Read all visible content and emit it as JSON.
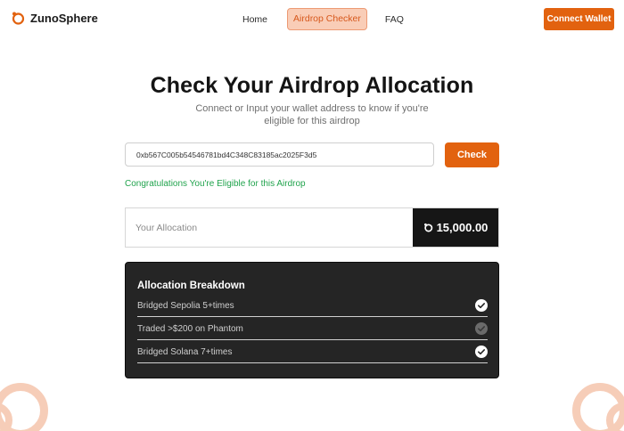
{
  "header": {
    "brand": "ZunoSphere",
    "nav": [
      {
        "label": "Home"
      },
      {
        "label": "Airdrop Checker"
      },
      {
        "label": "FAQ"
      }
    ],
    "connect_label": "Connect Wallet"
  },
  "hero": {
    "title": "Check Your Airdrop Allocation",
    "subtitle": "Connect or Input your wallet address to know if you're eligible for this airdrop"
  },
  "checker": {
    "wallet_value": "0xb567C005b5454678​1bd4C348C83185ac2025F3d5",
    "check_label": "Check",
    "eligible_message": "Congratulations You're Eligible for this Airdrop"
  },
  "allocation": {
    "label": "Your Allocation",
    "amount": "15,000.00"
  },
  "breakdown": {
    "title": "Allocation Breakdown",
    "items": [
      {
        "label": "Bridged Sepolia 5+times",
        "checked": true
      },
      {
        "label": "Traded >$200 on Phantom",
        "checked": false
      },
      {
        "label": "Bridged Solana 7+times",
        "checked": true
      }
    ]
  },
  "colors": {
    "accent": "#e2620f",
    "success": "#21a34d",
    "dark_panel": "#252525"
  }
}
